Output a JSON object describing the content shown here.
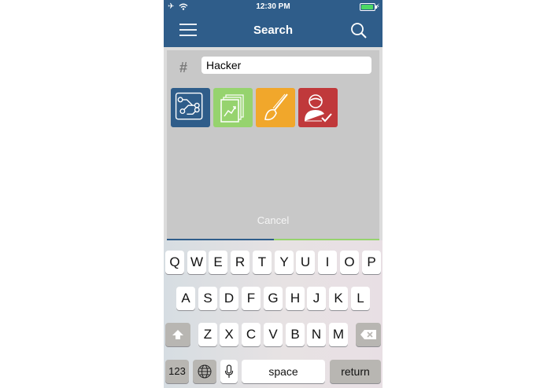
{
  "status_bar": {
    "time": "12:30 PM",
    "icons": [
      "airplane-icon",
      "wifi-icon",
      "battery-icon",
      "charging-bolt-icon"
    ]
  },
  "nav": {
    "title": "Search",
    "left_icon": "hamburger-menu-icon",
    "right_icon": "search-icon"
  },
  "search": {
    "hash_symbol": "#",
    "value": "Hacker"
  },
  "categories": [
    {
      "icon": "circuit-board-icon",
      "color": "#2f5d8a"
    },
    {
      "icon": "growth-chart-icon",
      "color": "#96d36e"
    },
    {
      "icon": "paint-brush-icon",
      "color": "#f1a72b"
    },
    {
      "icon": "verified-user-icon",
      "color": "#c0393b"
    }
  ],
  "cancel_label": "Cancel",
  "keyboard": {
    "row1": [
      "Q",
      "W",
      "E",
      "R",
      "T",
      "Y",
      "U",
      "I",
      "O",
      "P"
    ],
    "row2": [
      "A",
      "S",
      "D",
      "F",
      "G",
      "H",
      "J",
      "K",
      "L"
    ],
    "row3": [
      "Z",
      "X",
      "C",
      "V",
      "B",
      "N",
      "M"
    ],
    "shift_icon": "shift-arrow-icon",
    "delete_icon": "backspace-icon",
    "numbers_label": "123",
    "globe_icon": "globe-icon",
    "mic_icon": "microphone-icon",
    "space_label": "space",
    "return_label": "return"
  }
}
